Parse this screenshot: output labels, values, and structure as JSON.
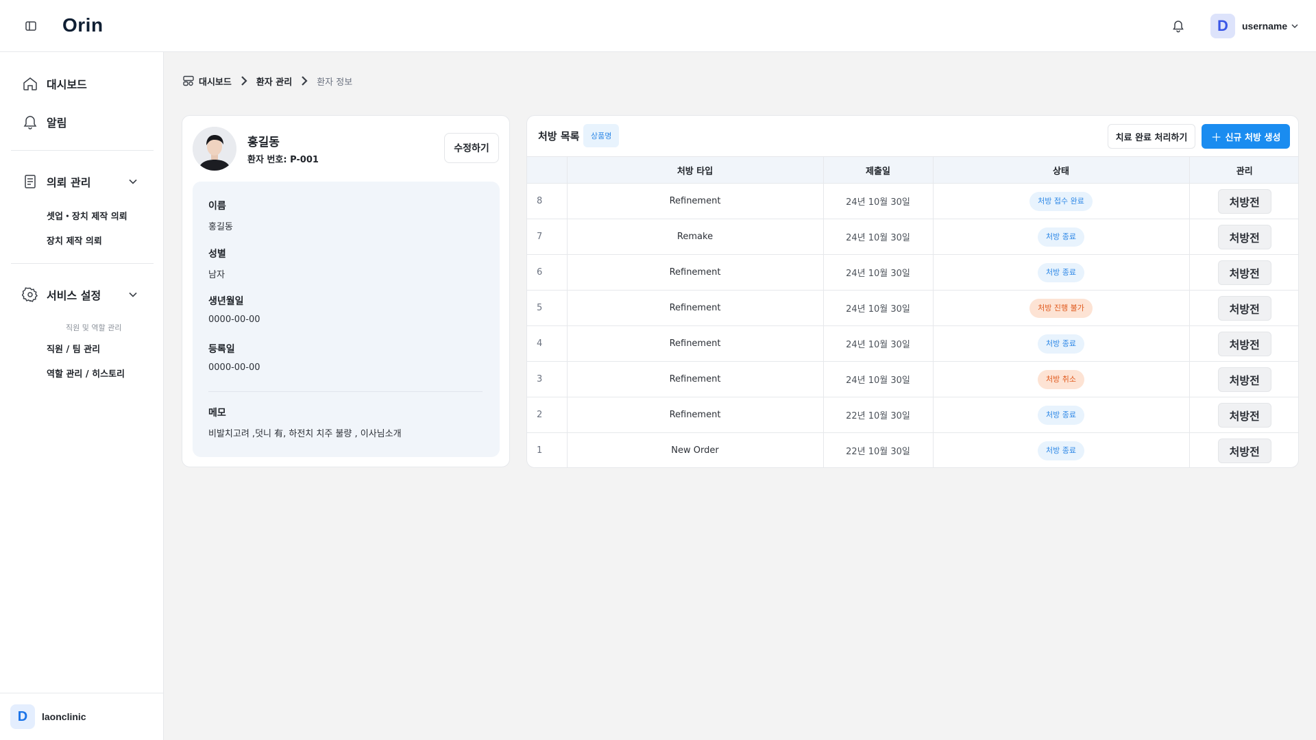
{
  "header": {
    "logo": "Orin",
    "username": "username",
    "avatar_letter": "D",
    "icons": [
      "sidebar-toggle-icon",
      "bell-icon",
      "chevron-down-icon"
    ]
  },
  "sidebar": {
    "items": [
      {
        "label": "대시보드",
        "icon": "home-icon"
      },
      {
        "label": "알림",
        "icon": "bell-icon"
      },
      {
        "label": "의뢰 관리",
        "icon": "document-icon"
      },
      {
        "label": "서비스 설정",
        "icon": "gear-icon"
      }
    ],
    "order_sub": [
      "셋업・장치 제작 의뢰",
      "장치 제작 의뢰"
    ],
    "service_caption": "직원 및 역할 관리",
    "service_sub": [
      "직원 / 팀 관리",
      "역할 관리 / 히스토리"
    ],
    "clinic": {
      "letter": "D",
      "name": "laonclinic"
    }
  },
  "breadcrumb": {
    "items": [
      "대시보드",
      "환자 관리"
    ],
    "current": "환자 정보"
  },
  "patient": {
    "name": "홍길동",
    "number": "환자 번호: P-001",
    "edit_label": "수정하기",
    "fields": [
      {
        "label": "이름",
        "value": "홍길동"
      },
      {
        "label": "성별",
        "value": "남자"
      },
      {
        "label": "생년월일",
        "value": "0000-00-00"
      },
      {
        "label": "등록일",
        "value": "0000-00-00"
      }
    ],
    "memo_label": "메모",
    "memo": "비발치고려 ,덧니 有, 하전치 치주 불량 ,  이사님소개"
  },
  "prescriptions": {
    "title": "처방 목록",
    "tag": "상품명",
    "complete_label": "치료 완료 처리하기",
    "new_label": "신규 처방 생성",
    "columns": [
      "",
      "처방 타입",
      "제출일",
      "상태",
      "관리"
    ],
    "rows": [
      {
        "num": "8",
        "type": "Refinement",
        "date": "24년 10월 30일",
        "status": "처방 접수 완료",
        "status_color": "#2e88e6",
        "manage": "처방전"
      },
      {
        "num": "7",
        "type": "Remake",
        "date": "24년 10월 30일",
        "status": "처방 종료",
        "status_color": "#2e88e6",
        "manage": "처방전"
      },
      {
        "num": "6",
        "type": "Refinement",
        "date": "24년 10월 30일",
        "status": "처방 종료",
        "status_color": "#2e88e6",
        "manage": "처방전"
      },
      {
        "num": "5",
        "type": "Refinement",
        "date": "24년 10월 30일",
        "status": "처방 진행 불가",
        "status_color": "#e05a1e",
        "manage": "처방전"
      },
      {
        "num": "4",
        "type": "Refinement",
        "date": "24년 10월 30일",
        "status": "처방 종료",
        "status_color": "#2e88e6",
        "manage": "처방전"
      },
      {
        "num": "3",
        "type": "Refinement",
        "date": "24년 10월 30일",
        "status": "처방 취소",
        "status_color": "#e05a1e",
        "manage": "처방전"
      },
      {
        "num": "2",
        "type": "Refinement",
        "date": "22년 10월 30일",
        "status": "처방 종료",
        "status_color": "#2e88e6",
        "manage": "처방전"
      },
      {
        "num": "1",
        "type": "New Order",
        "date": "22년 10월 30일",
        "status": "처방 종료",
        "status_color": "#2e88e6",
        "manage": "처방전"
      }
    ]
  }
}
